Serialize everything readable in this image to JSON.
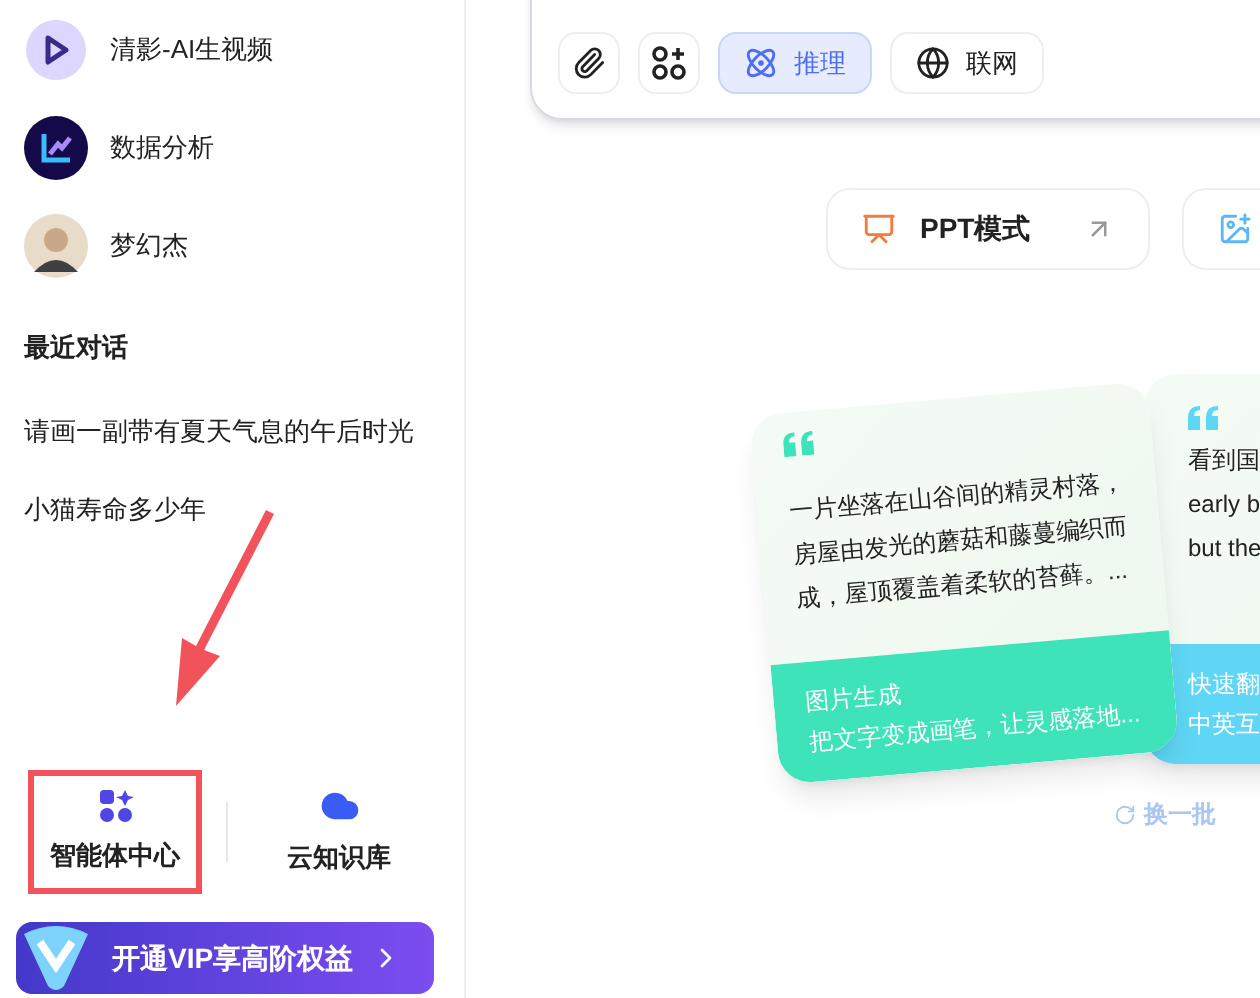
{
  "sidebar": {
    "agents": [
      {
        "name": "清影-AI生视频",
        "kind": "video"
      },
      {
        "name": "数据分析",
        "kind": "chart"
      },
      {
        "name": "梦幻杰",
        "kind": "person"
      }
    ],
    "recent_heading": "最近对话",
    "recent": [
      "请画一副带有夏天气息的午后时光",
      "小猫寿命多少年"
    ],
    "bottom_nav": [
      {
        "label": "智能体中心",
        "kind": "agents",
        "highlighted": true
      },
      {
        "label": "云知识库",
        "kind": "cloud",
        "highlighted": false
      }
    ],
    "vip_button": "开通VIP享高阶权益"
  },
  "toolbar": [
    {
      "kind": "attach",
      "selected": false
    },
    {
      "kind": "apps",
      "selected": false
    },
    {
      "kind": "reason",
      "label": "推理",
      "selected": true
    },
    {
      "kind": "web",
      "label": "联网",
      "selected": false
    }
  ],
  "modes": [
    {
      "kind": "ppt",
      "label": "PPT模式"
    },
    {
      "kind": "image"
    }
  ],
  "cards": [
    {
      "quote_lines": [
        "一片坐落在山谷间的精灵村落，",
        "房屋由发光的蘑菇和藤蔓编织而",
        "成，屋顶覆盖着柔软的苔藓。..."
      ],
      "title": "图片生成",
      "subtitle": "把文字变成画笔，让灵感落地...",
      "color": "#3ee3b9"
    },
    {
      "quote_lines": [
        "看到国",
        "early b",
        "but the"
      ],
      "title": "快速翻",
      "subtitle": "中英互",
      "color": "#5fd6f5"
    }
  ],
  "refresh": "换一批"
}
